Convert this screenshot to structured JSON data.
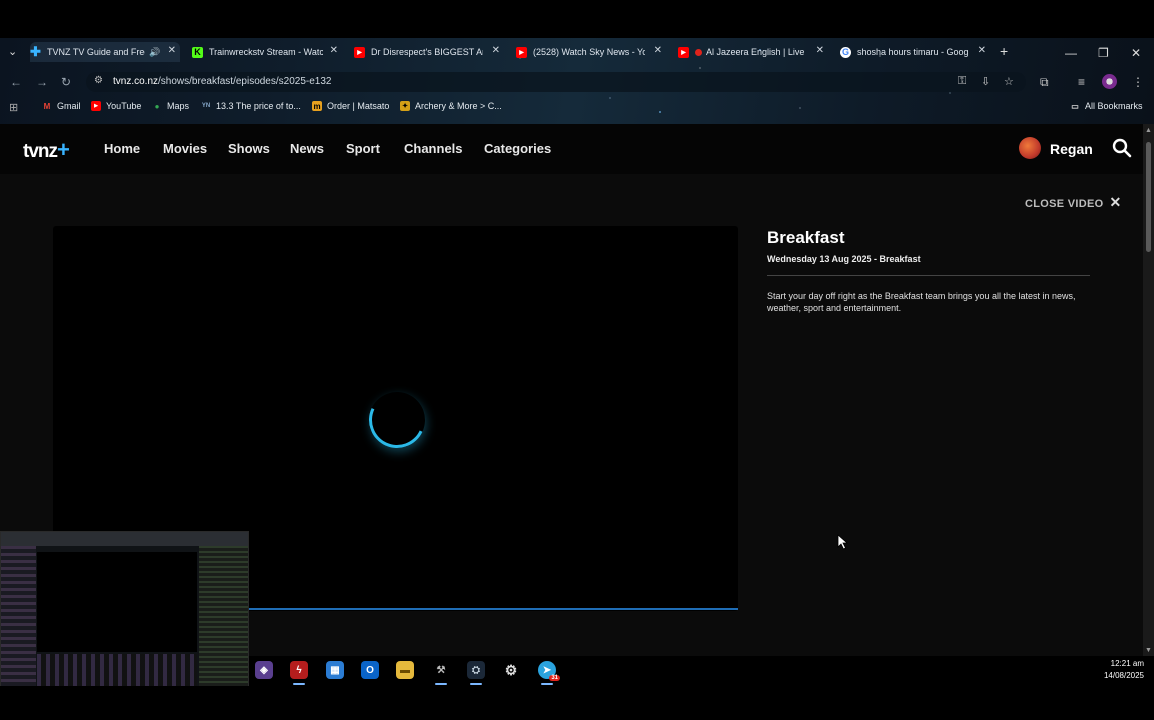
{
  "browser": {
    "tabs": [
      {
        "title": "TVNZ TV Guide and Free",
        "icon": "tvnz-plus-icon",
        "color": "#39b4ff",
        "active": true
      },
      {
        "title": "Trainwreckstv Stream - Watc",
        "icon": "kick-icon",
        "color": "#53fc18"
      },
      {
        "title": "Dr Disrespect's BIGGEST An",
        "icon": "youtube-icon",
        "color": "#ff0000"
      },
      {
        "title": "(2528) Watch Sky News - Yo",
        "icon": "youtube-icon",
        "color": "#ff0000"
      },
      {
        "title": "Al Jazeera English | Live",
        "icon": "youtube-icon",
        "color": "#ff0000"
      },
      {
        "title": "shosha hours timaru - Goog",
        "icon": "google-icon",
        "color": "#4285f4"
      }
    ],
    "new_tab": "+",
    "url_host": "tvnz.co.nz",
    "url_path": "/shows/breakfast/episodes/s2025-e132",
    "bookmarks": [
      {
        "label": "Gmail",
        "icon": "gmail-icon"
      },
      {
        "label": "YouTube",
        "icon": "youtube-icon"
      },
      {
        "label": "Maps",
        "icon": "maps-icon"
      },
      {
        "label": "13.3 The price of to...",
        "icon": "doc-icon"
      },
      {
        "label": "Order | Matsato",
        "icon": "matsato-icon"
      },
      {
        "label": "Archery & More > C...",
        "icon": "archery-icon"
      }
    ],
    "all_bookmarks": "All Bookmarks"
  },
  "site": {
    "logo": "tvnz",
    "logo_plus": "+",
    "nav": [
      "Home",
      "Movies",
      "Shows",
      "News",
      "Sport",
      "Channels",
      "Categories"
    ],
    "user": "Regan"
  },
  "video": {
    "close_label": "CLOSE VIDEO",
    "progress": 1.0
  },
  "episode": {
    "title": "Breakfast",
    "subtitle": "Wednesday 13 Aug 2025 - Breakfast",
    "description": "Start your day off right as the Breakfast team brings you all the latest in news, weather, sport and entertainment."
  },
  "taskbar": {
    "apps": [
      "copilot-icon",
      "flash-icon",
      "store-icon",
      "outlook-icon",
      "file-explorer-icon",
      "tool-icon",
      "steam-icon",
      "settings-icon",
      "telegram-icon"
    ],
    "telegram_badge": "31",
    "time": "12:21 am",
    "date": "14/08/2025"
  },
  "colors": {
    "accent": "#39b4ff",
    "spinner": "#2bb9e8",
    "progress": "#1f6db5"
  }
}
